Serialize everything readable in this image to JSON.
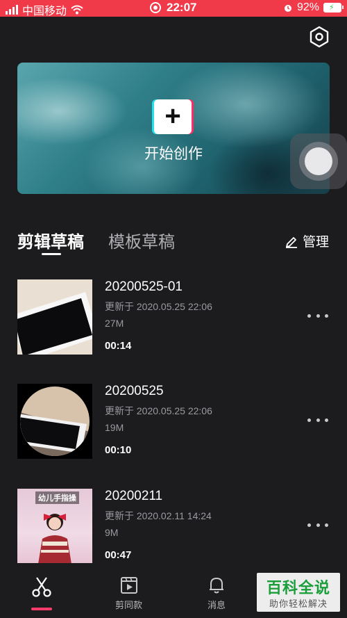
{
  "status_bar": {
    "carrier": "中国移动",
    "time": "22:07",
    "battery_percent": "92%",
    "icons": [
      "signal-icon",
      "wifi-icon",
      "screen-record-icon",
      "alarm-icon",
      "battery-icon"
    ],
    "background": "#f03a4a"
  },
  "header": {
    "settings_icon": "settings-hexagon-icon"
  },
  "banner": {
    "create_label": "开始创作",
    "plus_symbol": "+"
  },
  "tabs": [
    {
      "label": "剪辑草稿",
      "active": true
    },
    {
      "label": "模板草稿",
      "active": false
    }
  ],
  "manage": {
    "label": "管理",
    "icon": "edit-pen-icon"
  },
  "drafts": [
    {
      "title": "20200525-01",
      "updated": "更新于 2020.05.25 22:06",
      "size": "27M",
      "duration": "00:14"
    },
    {
      "title": "20200525",
      "updated": "更新于 2020.05.25 22:06",
      "size": "19M",
      "duration": "00:10"
    },
    {
      "title": "20200211",
      "updated": "更新于 2020.02.11 14:24",
      "size": "9M",
      "duration": "00:47",
      "thumb_caption": "幼儿手指操"
    }
  ],
  "bottom_nav": [
    {
      "label": "",
      "icon": "scissors-icon",
      "active": true
    },
    {
      "label": "剪同款",
      "icon": "template-video-icon",
      "active": false
    },
    {
      "label": "消息",
      "icon": "bell-icon",
      "active": false
    }
  ],
  "watermark": {
    "title": "百科全说",
    "subtitle": "助你轻松解决"
  },
  "colors": {
    "accent": "#ff3b6b",
    "background": "#1c1c1e",
    "secondary_text": "#9a9aa0"
  }
}
